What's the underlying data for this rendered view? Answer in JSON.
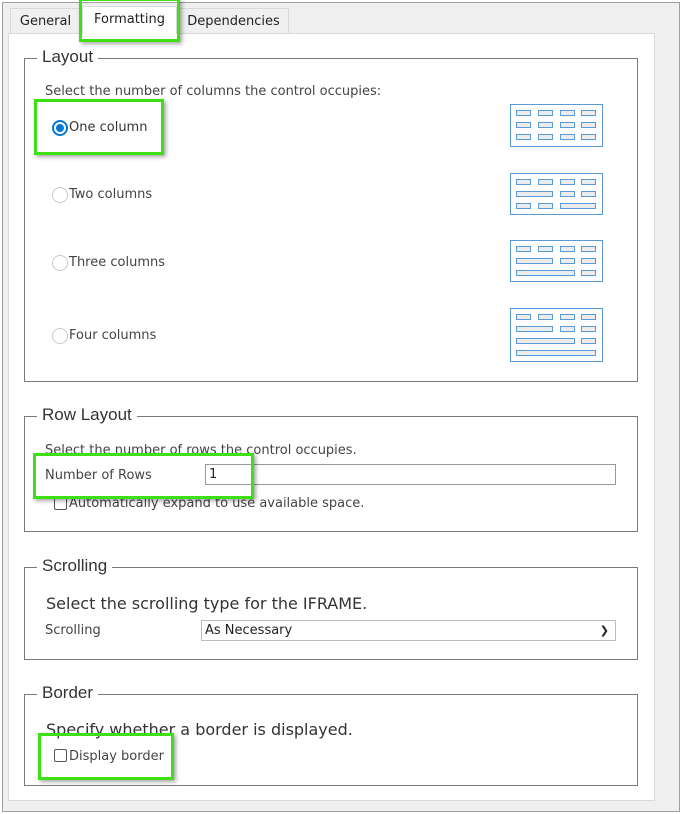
{
  "tabs": [
    {
      "label": "General"
    },
    {
      "label": "Formatting",
      "active": true
    },
    {
      "label": "Dependencies"
    }
  ],
  "layout": {
    "legend": "Layout",
    "instruction": "Select the number of columns the control occupies:",
    "options": [
      {
        "label": "One column",
        "selected": true
      },
      {
        "label": "Two columns",
        "selected": false
      },
      {
        "label": "Three columns",
        "selected": false
      },
      {
        "label": "Four columns",
        "selected": false
      }
    ]
  },
  "row_layout": {
    "legend": "Row Layout",
    "instruction": "Select the number of rows the control occupies.",
    "rows_label": "Number of Rows",
    "rows_value": "1",
    "auto_expand_label": "Automatically expand to use available space.",
    "auto_expand_checked": false
  },
  "scrolling": {
    "legend": "Scrolling",
    "instruction": "Select the scrolling type for the IFRAME.",
    "label": "Scrolling",
    "value": "As Necessary"
  },
  "border": {
    "legend": "Border",
    "instruction": "Specify whether a border is displayed.",
    "display_label": "Display border",
    "display_checked": false
  },
  "colors": {
    "accent": "#0078d7",
    "highlight": "#3de014",
    "icon_stroke": "#5b9bd5"
  }
}
